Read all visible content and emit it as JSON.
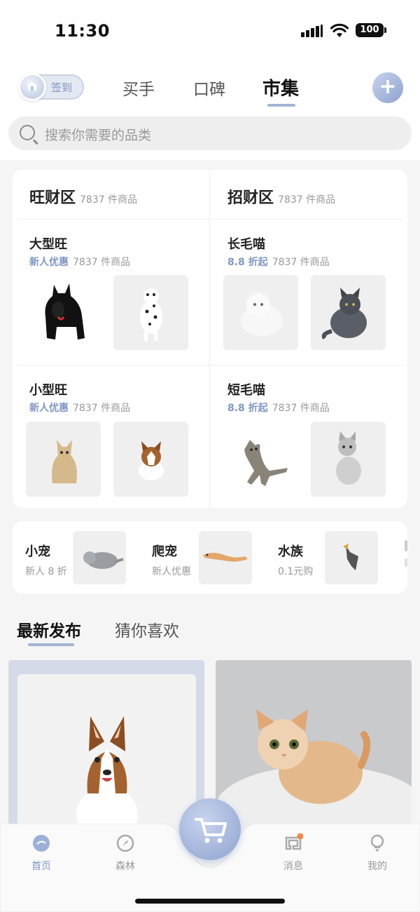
{
  "status": {
    "time": "11:30",
    "battery": "100"
  },
  "header": {
    "checkin_label": "签到",
    "tabs": [
      {
        "label": "买手"
      },
      {
        "label": "口碑"
      },
      {
        "label": "市集"
      }
    ]
  },
  "search": {
    "placeholder": "搜索你需要的品类"
  },
  "zones": [
    {
      "title": "旺财区",
      "count": "7837 件商品",
      "sections": [
        {
          "title": "大型旺",
          "promo": "新人优惠",
          "count": "7837 件商品"
        },
        {
          "title": "小型旺",
          "promo": "新人优惠",
          "count": "7837 件商品"
        }
      ]
    },
    {
      "title": "招财区",
      "count": "7837 件商品",
      "sections": [
        {
          "title": "长毛喵",
          "promo": "8.8 折起",
          "count": "7837 件商品"
        },
        {
          "title": "短毛喵",
          "promo": "8.8 折起",
          "count": "7837 件商品"
        }
      ]
    }
  ],
  "categories": [
    {
      "name": "小宠",
      "sub": "新人 8 折"
    },
    {
      "name": "爬宠",
      "sub": "新人优惠"
    },
    {
      "name": "水族",
      "sub": "0.1元购"
    }
  ],
  "feed_tabs": [
    {
      "label": "最新发布"
    },
    {
      "label": "猜你喜欢"
    }
  ],
  "bottom_nav": [
    {
      "label": "首页"
    },
    {
      "label": "森林"
    },
    {
      "label": "消息"
    },
    {
      "label": "我的"
    }
  ],
  "colors": {
    "accent": "#8ea2cf",
    "accent_text": "#7d96c8",
    "badge": "#f08a4b"
  }
}
